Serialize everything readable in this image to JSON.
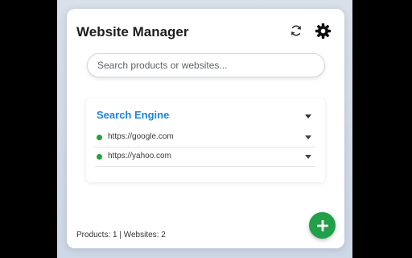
{
  "header": {
    "title": "Website Manager",
    "refresh_icon": "refresh-icon",
    "settings_icon": "gear-icon"
  },
  "search": {
    "placeholder": "Search products or websites...",
    "value": ""
  },
  "groups": [
    {
      "title": "Search Engine",
      "expanded": true,
      "sites": [
        {
          "url": "https://google.com",
          "status": "online"
        },
        {
          "url": "https://yahoo.com",
          "status": "online"
        }
      ]
    }
  ],
  "footer": {
    "counts": "Products: 1 | Websites: 2"
  },
  "fab": {
    "icon": "plus-icon"
  },
  "colors": {
    "accent": "#1a86e0",
    "status_online": "#23a23c",
    "fab": "#21a04a"
  }
}
